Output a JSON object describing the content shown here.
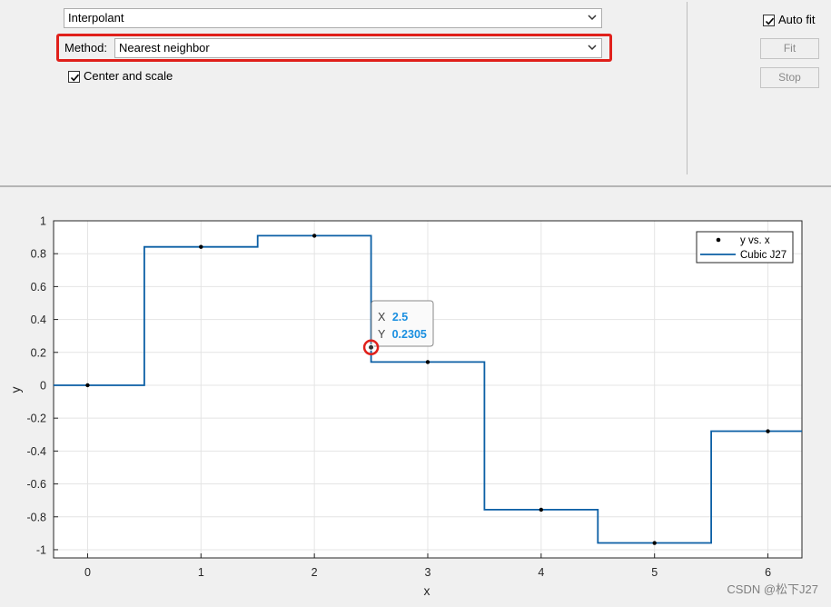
{
  "fit_type": {
    "value": "Interpolant"
  },
  "method": {
    "label": "Method:",
    "value": "Nearest neighbor"
  },
  "center_scale": {
    "label": "Center and scale",
    "checked": true
  },
  "auto_fit": {
    "label": "Auto fit",
    "checked": true
  },
  "buttons": {
    "fit": "Fit",
    "stop": "Stop"
  },
  "chart_data": {
    "type": "line",
    "xlabel": "x",
    "ylabel": "y",
    "xlim": [
      -0.3,
      6.3
    ],
    "ylim": [
      -1.05,
      1
    ],
    "x_ticks": [
      "0",
      "1",
      "2",
      "3",
      "4",
      "5",
      "6"
    ],
    "y_ticks": [
      "-1",
      "-0.8",
      "-0.6",
      "-0.4",
      "-0.2",
      "0",
      "0.2",
      "0.4",
      "0.6",
      "0.8",
      "1"
    ],
    "grid": true,
    "legend_position": "top-right",
    "series": [
      {
        "name": "y vs. x",
        "style": "points",
        "color": "#000000",
        "x": [
          0,
          1,
          2,
          3,
          4,
          5,
          6
        ],
        "y": [
          0,
          0.8415,
          0.9093,
          0.1411,
          -0.7568,
          -0.9589,
          -0.2794
        ]
      },
      {
        "name": "Cubic J27",
        "style": "nearest-step",
        "color": "#0b5fa5",
        "x": [
          0,
          1,
          2,
          3,
          4,
          5,
          6
        ],
        "y": [
          0,
          0.8415,
          0.9093,
          0.1411,
          -0.7568,
          -0.9589,
          -0.2794
        ]
      }
    ],
    "datatip": {
      "x_label": "X",
      "x_value": "2.5",
      "y_label": "Y",
      "y_value": "0.2305",
      "x": 2.5,
      "y": 0.2305
    }
  },
  "watermark": "CSDN @松下J27"
}
